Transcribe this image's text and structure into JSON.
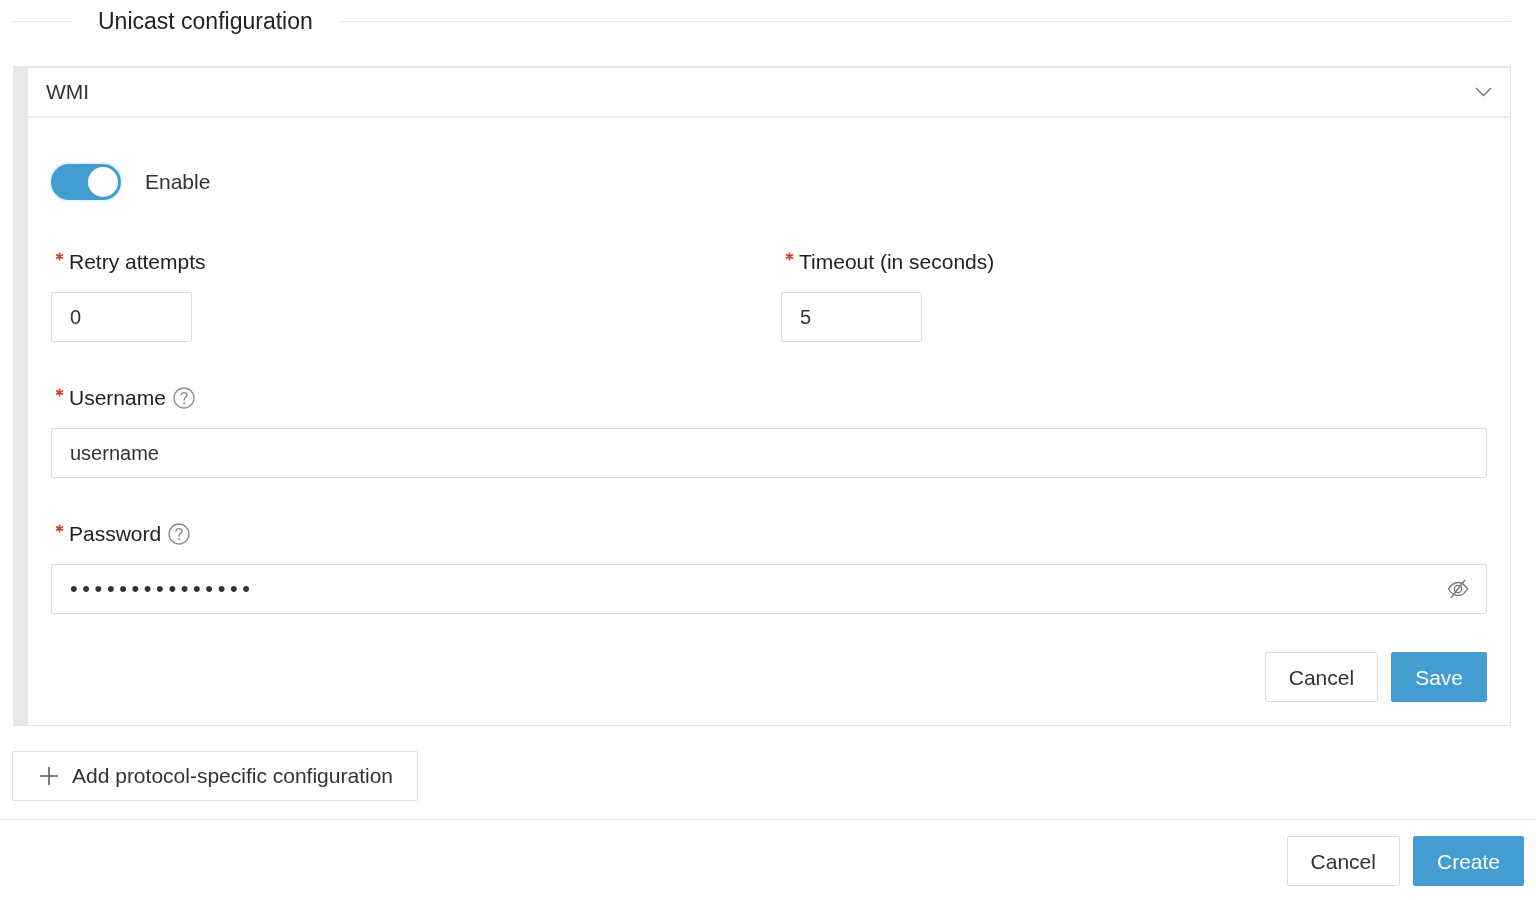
{
  "section": {
    "title": "Unicast configuration"
  },
  "protocol": {
    "name": "WMI",
    "expanded": true,
    "enable": {
      "label": "Enable",
      "on": true
    },
    "fields": [
      {
        "kind": "number",
        "label": "Retry attempts",
        "required": true,
        "help": false,
        "value": "0"
      },
      {
        "kind": "number",
        "label": "Timeout (in seconds)",
        "required": true,
        "help": false,
        "value": "5"
      },
      {
        "kind": "text",
        "label": "Username",
        "required": true,
        "help": true,
        "value": "username"
      },
      {
        "kind": "password",
        "label": "Password",
        "required": true,
        "help": true,
        "value": "•••••••••••••••"
      }
    ],
    "actions": [
      {
        "kind": "secondary",
        "label": "Cancel"
      },
      {
        "kind": "primary",
        "label": "Save"
      }
    ]
  },
  "add_button": {
    "label": "Add protocol-specific configuration"
  },
  "footer": {
    "actions": [
      {
        "kind": "secondary",
        "label": "Cancel"
      },
      {
        "kind": "primary",
        "label": "Create"
      }
    ]
  }
}
